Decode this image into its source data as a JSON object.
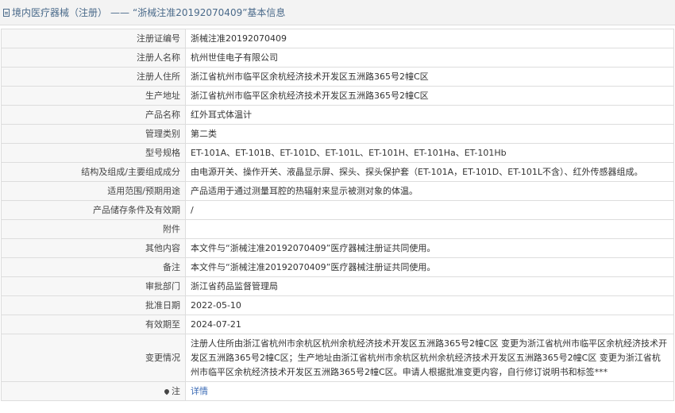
{
  "header": {
    "section": "境内医疗器械（注册）",
    "separator": "——",
    "title": "“浙械注准20192070409”基本信息"
  },
  "rows": [
    {
      "label": "注册证编号",
      "value": "浙械注准20192070409"
    },
    {
      "label": "注册人名称",
      "value": "杭州世佳电子有限公司"
    },
    {
      "label": "注册人住所",
      "value": "浙江省杭州市临平区余杭经济技术开发区五洲路365号2幢C区"
    },
    {
      "label": "生产地址",
      "value": "浙江省杭州市临平区余杭经济技术开发区五洲路365号2幢C区"
    },
    {
      "label": "产品名称",
      "value": "红外耳式体温计"
    },
    {
      "label": "管理类别",
      "value": "第二类"
    },
    {
      "label": "型号规格",
      "value": "ET-101A、ET-101B、ET-101D、ET-101L、ET-101H、ET-101Ha、ET-101Hb"
    },
    {
      "label": "结构及组成/主要组成成分",
      "value": "由电源开关、操作开关、液晶显示屏、探头、探头保护套（ET-101A，ET-101D、ET-101L不含）、红外传感器组成。"
    },
    {
      "label": "适用范围/预期用途",
      "value": "产品适用于通过测量耳腔的热辐射来显示被测对象的体温。"
    },
    {
      "label": "产品储存条件及有效期",
      "value": "/"
    },
    {
      "label": "附件",
      "value": ""
    },
    {
      "label": "其他内容",
      "value": "本文件与“浙械注准20192070409”医疗器械注册证共同使用。"
    },
    {
      "label": "备注",
      "value": "本文件与“浙械注准20192070409”医疗器械注册证共同使用。"
    },
    {
      "label": "审批部门",
      "value": "浙江省药品监督管理局"
    },
    {
      "label": "批准日期",
      "value": "2022-05-10"
    },
    {
      "label": "有效期至",
      "value": "2024-07-21"
    },
    {
      "label": "变更情况",
      "value": "注册人住所由浙江省杭州市余杭区杭州余杭经济技术开发区五洲路365号2幢C区 变更为浙江省杭州市临平区余杭经济技术开发区五洲路365号2幢C区；生产地址由浙江省杭州市余杭区杭州余杭经济技术开发区五洲路365号2幢C区 变更为浙江省杭州市临平区余杭经济技术开发区五洲路365号2幢C区。申请人根据批准变更内容，自行修订说明书和标签***"
    }
  ],
  "footer_row": {
    "label": "注",
    "link": "详情"
  }
}
